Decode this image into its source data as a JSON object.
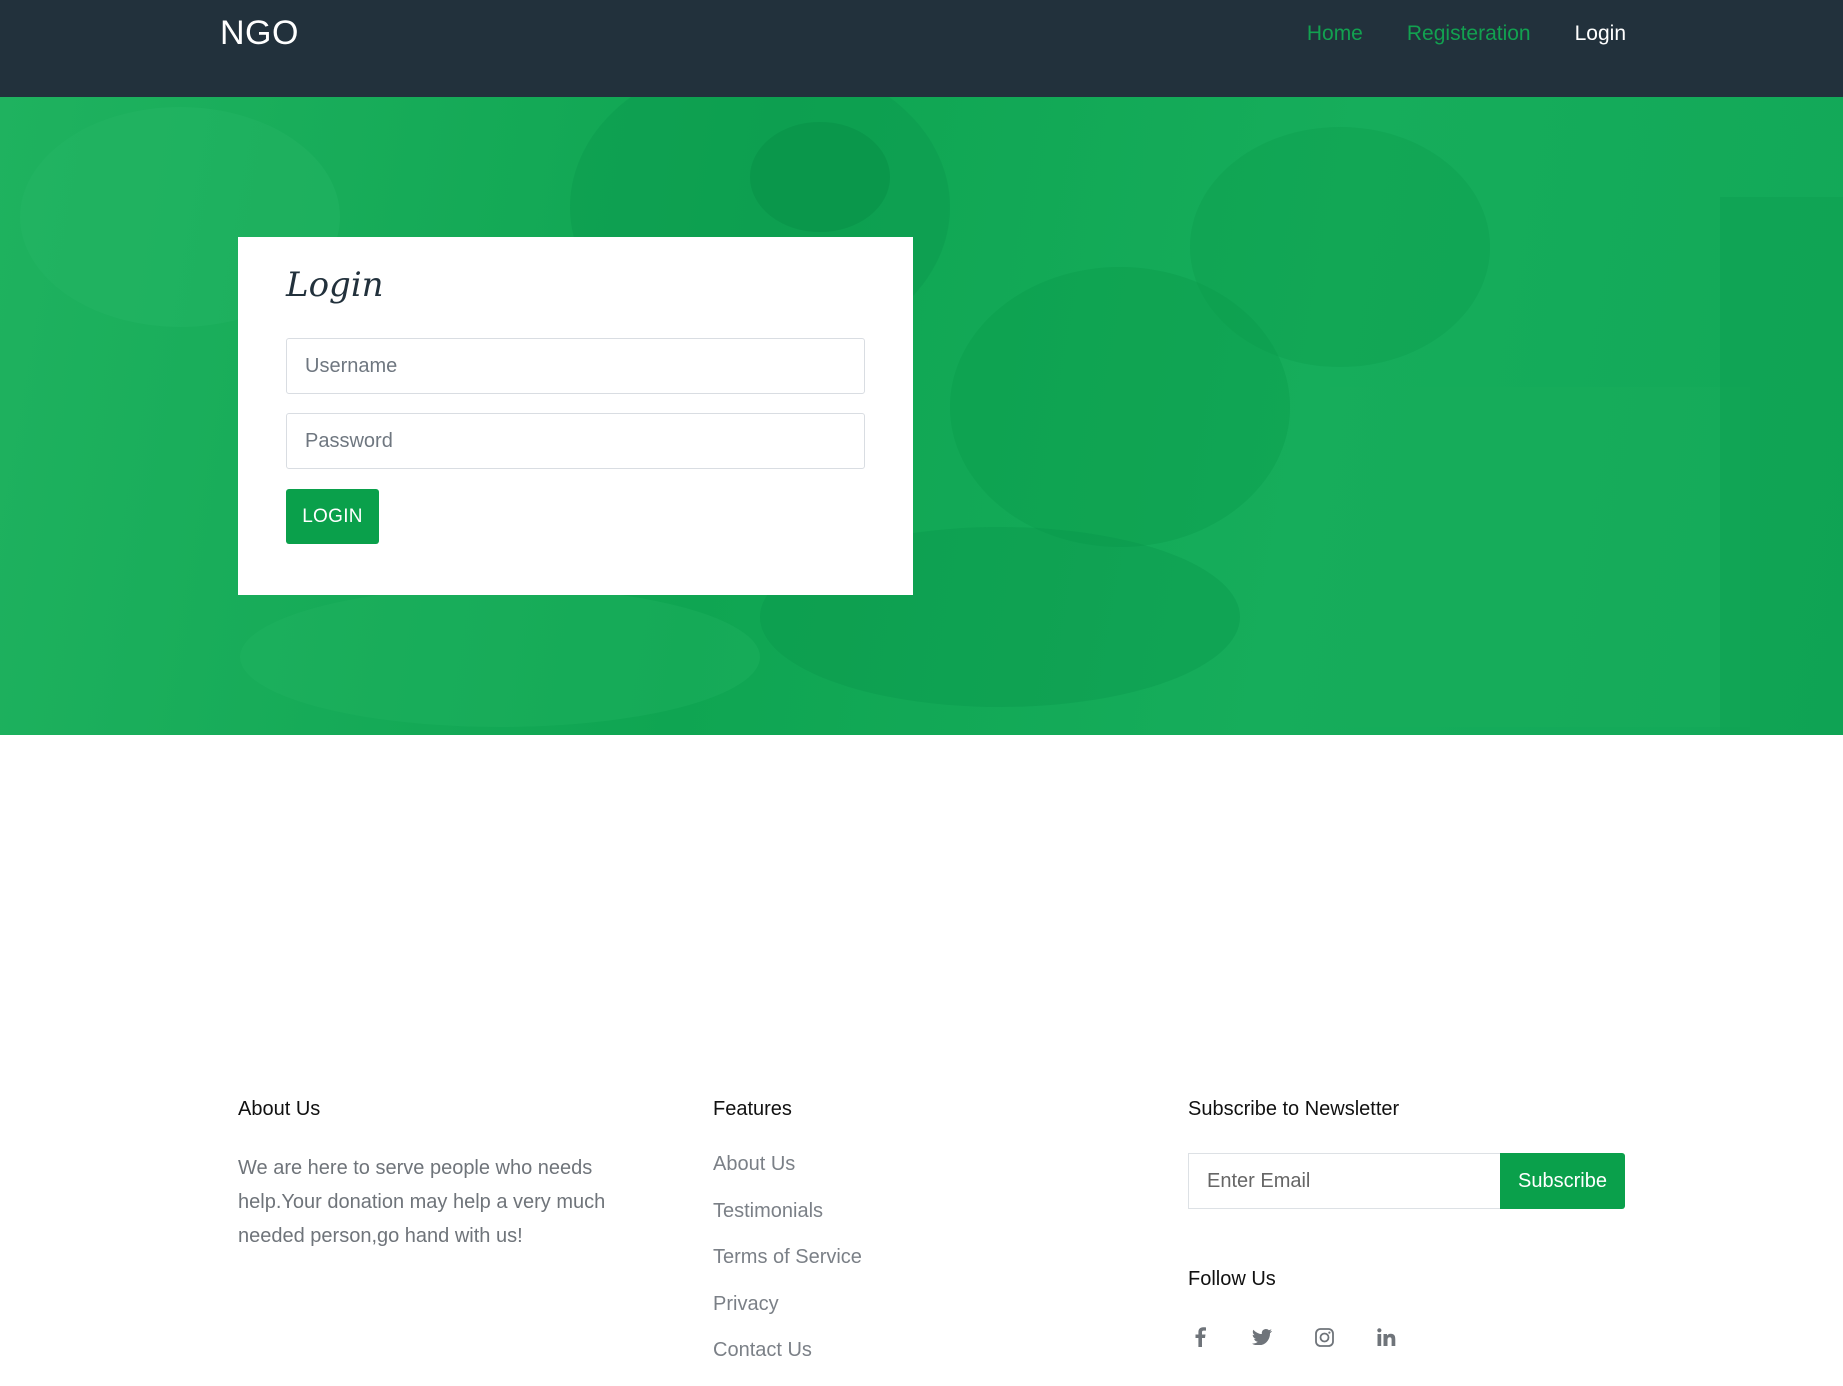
{
  "navbar": {
    "brand": "NGO",
    "links": [
      {
        "label": "Home"
      },
      {
        "label": "Registeration"
      },
      {
        "label": "Login"
      }
    ]
  },
  "login": {
    "title": "Login",
    "username_placeholder": "Username",
    "password_placeholder": "Password",
    "button_label": "LOGIN"
  },
  "footer": {
    "about": {
      "heading": "About Us",
      "text": "We are here to serve people who needs help.Your donation may help a very much needed person,go hand with us!"
    },
    "features": {
      "heading": "Features",
      "links": [
        "About Us",
        "Testimonials",
        "Terms of Service",
        "Privacy",
        "Contact Us"
      ]
    },
    "newsletter": {
      "heading": "Subscribe to Newsletter",
      "email_placeholder": "Enter Email",
      "button_label": "Subscribe"
    },
    "follow": {
      "heading": "Follow Us",
      "icons": [
        "facebook-icon",
        "twitter-icon",
        "instagram-icon",
        "linkedin-icon"
      ]
    }
  },
  "colors": {
    "navbar_bg": "#22313c",
    "accent_green": "#0aa04b",
    "nav_link_green": "#12a150",
    "text_muted": "#6f747a"
  }
}
